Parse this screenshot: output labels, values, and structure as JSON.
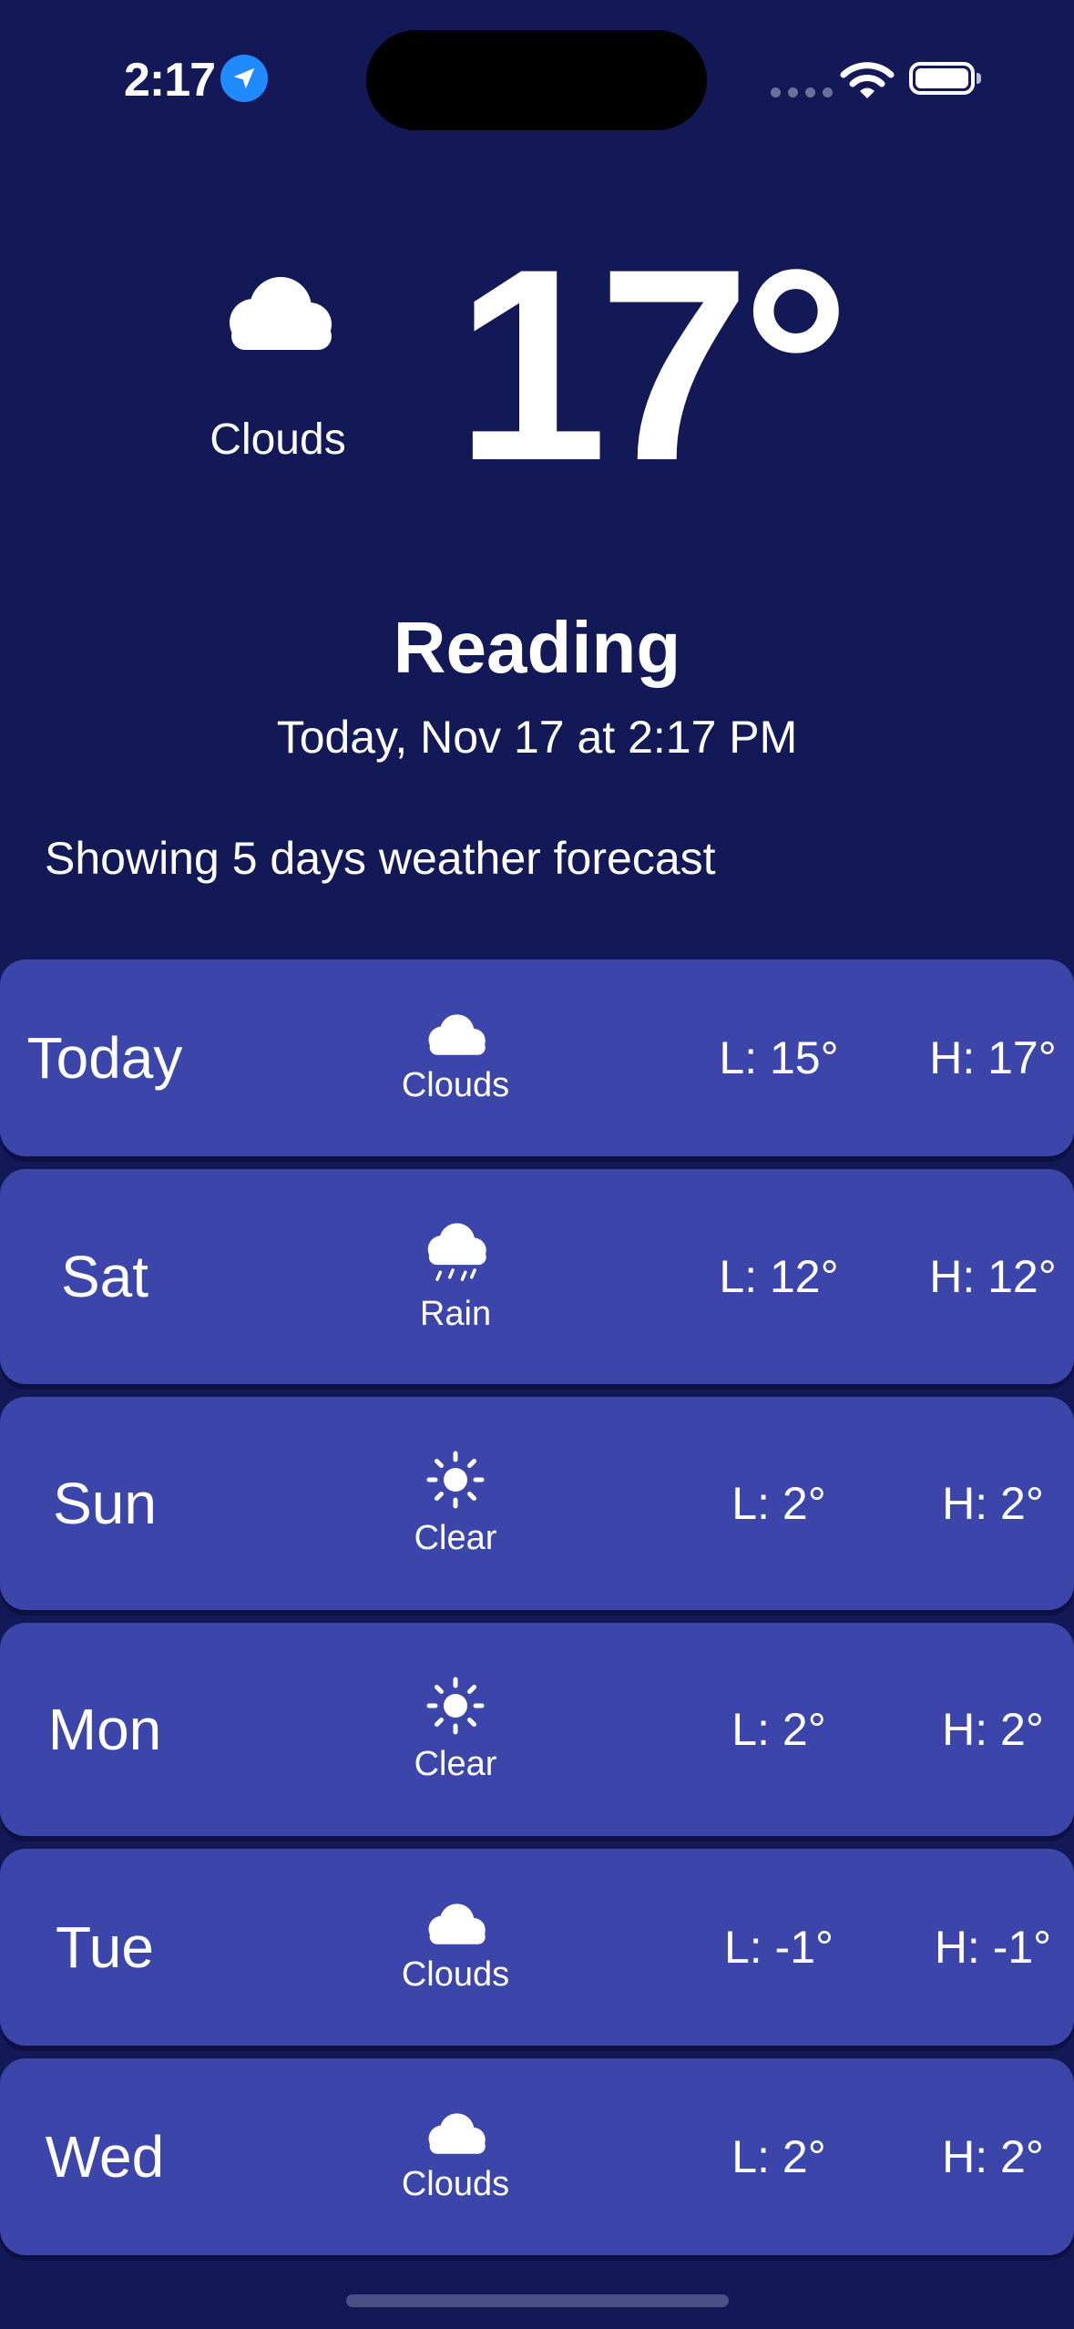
{
  "status_bar": {
    "time": "2:17",
    "icons": [
      "location-arrow-icon",
      "signal-icon",
      "wifi-icon",
      "battery-icon"
    ]
  },
  "current": {
    "condition": "Clouds",
    "icon": "cloud-icon",
    "temperature": "17°",
    "city": "Reading",
    "date": "Today, Nov 17 at 2:17 PM"
  },
  "forecast_note": "Showing 5 days weather forecast",
  "forecast": [
    {
      "day": "Today",
      "condition": "Clouds",
      "icon": "cloud-icon",
      "low": "L: 15°",
      "high": "H: 17°"
    },
    {
      "day": "Sat",
      "condition": "Rain",
      "icon": "rain-cloud-icon",
      "low": "L: 12°",
      "high": "H: 12°"
    },
    {
      "day": "Sun",
      "condition": "Clear",
      "icon": "sun-icon",
      "low": "L: 2°",
      "high": "H: 2°"
    },
    {
      "day": "Mon",
      "condition": "Clear",
      "icon": "sun-icon",
      "low": "L: 2°",
      "high": "H: 2°"
    },
    {
      "day": "Tue",
      "condition": "Clouds",
      "icon": "cloud-icon",
      "low": "L: -1°",
      "high": "H: -1°"
    },
    {
      "day": "Wed",
      "condition": "Clouds",
      "icon": "cloud-icon",
      "low": "L: 2°",
      "high": "H: 2°"
    }
  ],
  "colors": {
    "background": "#131857",
    "row": "#3c45a9",
    "accent": "#1f8bff"
  }
}
